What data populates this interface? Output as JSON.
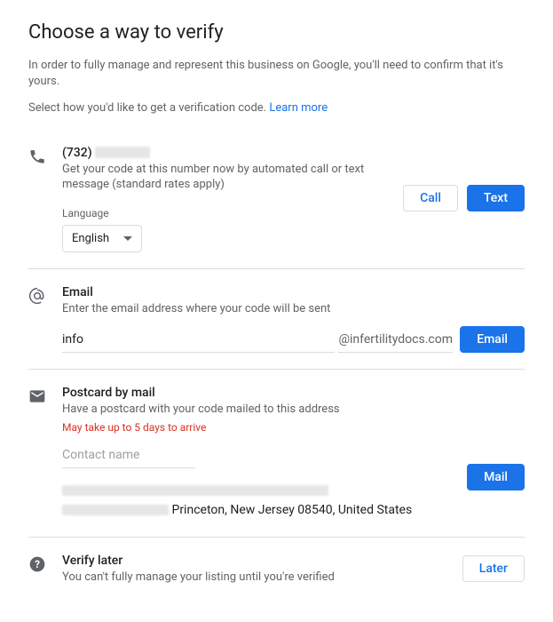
{
  "page": {
    "title": "Choose a way to verify",
    "intro1": "In order to fully manage and represent this business on Google, you'll need to confirm that it's yours.",
    "intro2": "Select how you'd like to get a verification code. ",
    "learn_more": "Learn more"
  },
  "phone": {
    "number_prefix": "(732) ",
    "desc": "Get your code at this number now by automated call or text message (standard rates apply)",
    "language_label": "Language",
    "language_value": "English",
    "call_btn": "Call",
    "text_btn": "Text"
  },
  "email": {
    "title": "Email",
    "desc": "Enter the email address where your code will be sent",
    "input_value": "info",
    "domain": "@infertilitydocs.com",
    "btn": "Email"
  },
  "mail": {
    "title": "Postcard by mail",
    "desc": "Have a postcard with your code mailed to this address",
    "warning": "May take up to 5 days to arrive",
    "contact_placeholder": "Contact name",
    "address_visible": "Princeton, New Jersey 08540, United States",
    "btn": "Mail"
  },
  "later": {
    "title": "Verify later",
    "desc": "You can't fully manage your listing until you're verified",
    "btn": "Later"
  }
}
